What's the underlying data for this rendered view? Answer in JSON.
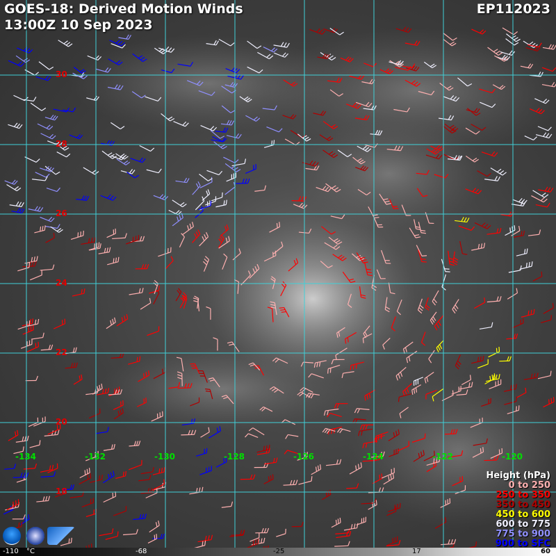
{
  "header": {
    "title_line1": "GOES-18: Derived Motion Winds",
    "title_line2": "13:00Z 10 Sep 2023",
    "storm_id": "EP112023"
  },
  "latitude_labels": [
    "30",
    "28",
    "26",
    "24",
    "22",
    "20",
    "18"
  ],
  "longitude_labels": [
    "-134",
    "-132",
    "-130",
    "-128",
    "-126",
    "-124",
    "-122",
    "-120"
  ],
  "legend": {
    "title": "Height (hPa)",
    "items": [
      {
        "label": "0 to 250",
        "color": "#ffb0b0"
      },
      {
        "label": "250 to 350",
        "color": "#ff0000"
      },
      {
        "label": "350 to 450",
        "color": "#b00000"
      },
      {
        "label": "450 to 600",
        "color": "#ffff00"
      },
      {
        "label": "600 to 775",
        "color": "#f0f0ff"
      },
      {
        "label": "775 to 900",
        "color": "#9090ff"
      },
      {
        "label": "900 to SFC",
        "color": "#0000ff"
      }
    ]
  },
  "colorbar": {
    "labels": [
      "-110",
      "°C",
      "-68",
      "-25",
      "17",
      "60"
    ]
  },
  "logos": [
    "noaa-icon",
    "nesdis-icon",
    "cira-icon"
  ]
}
